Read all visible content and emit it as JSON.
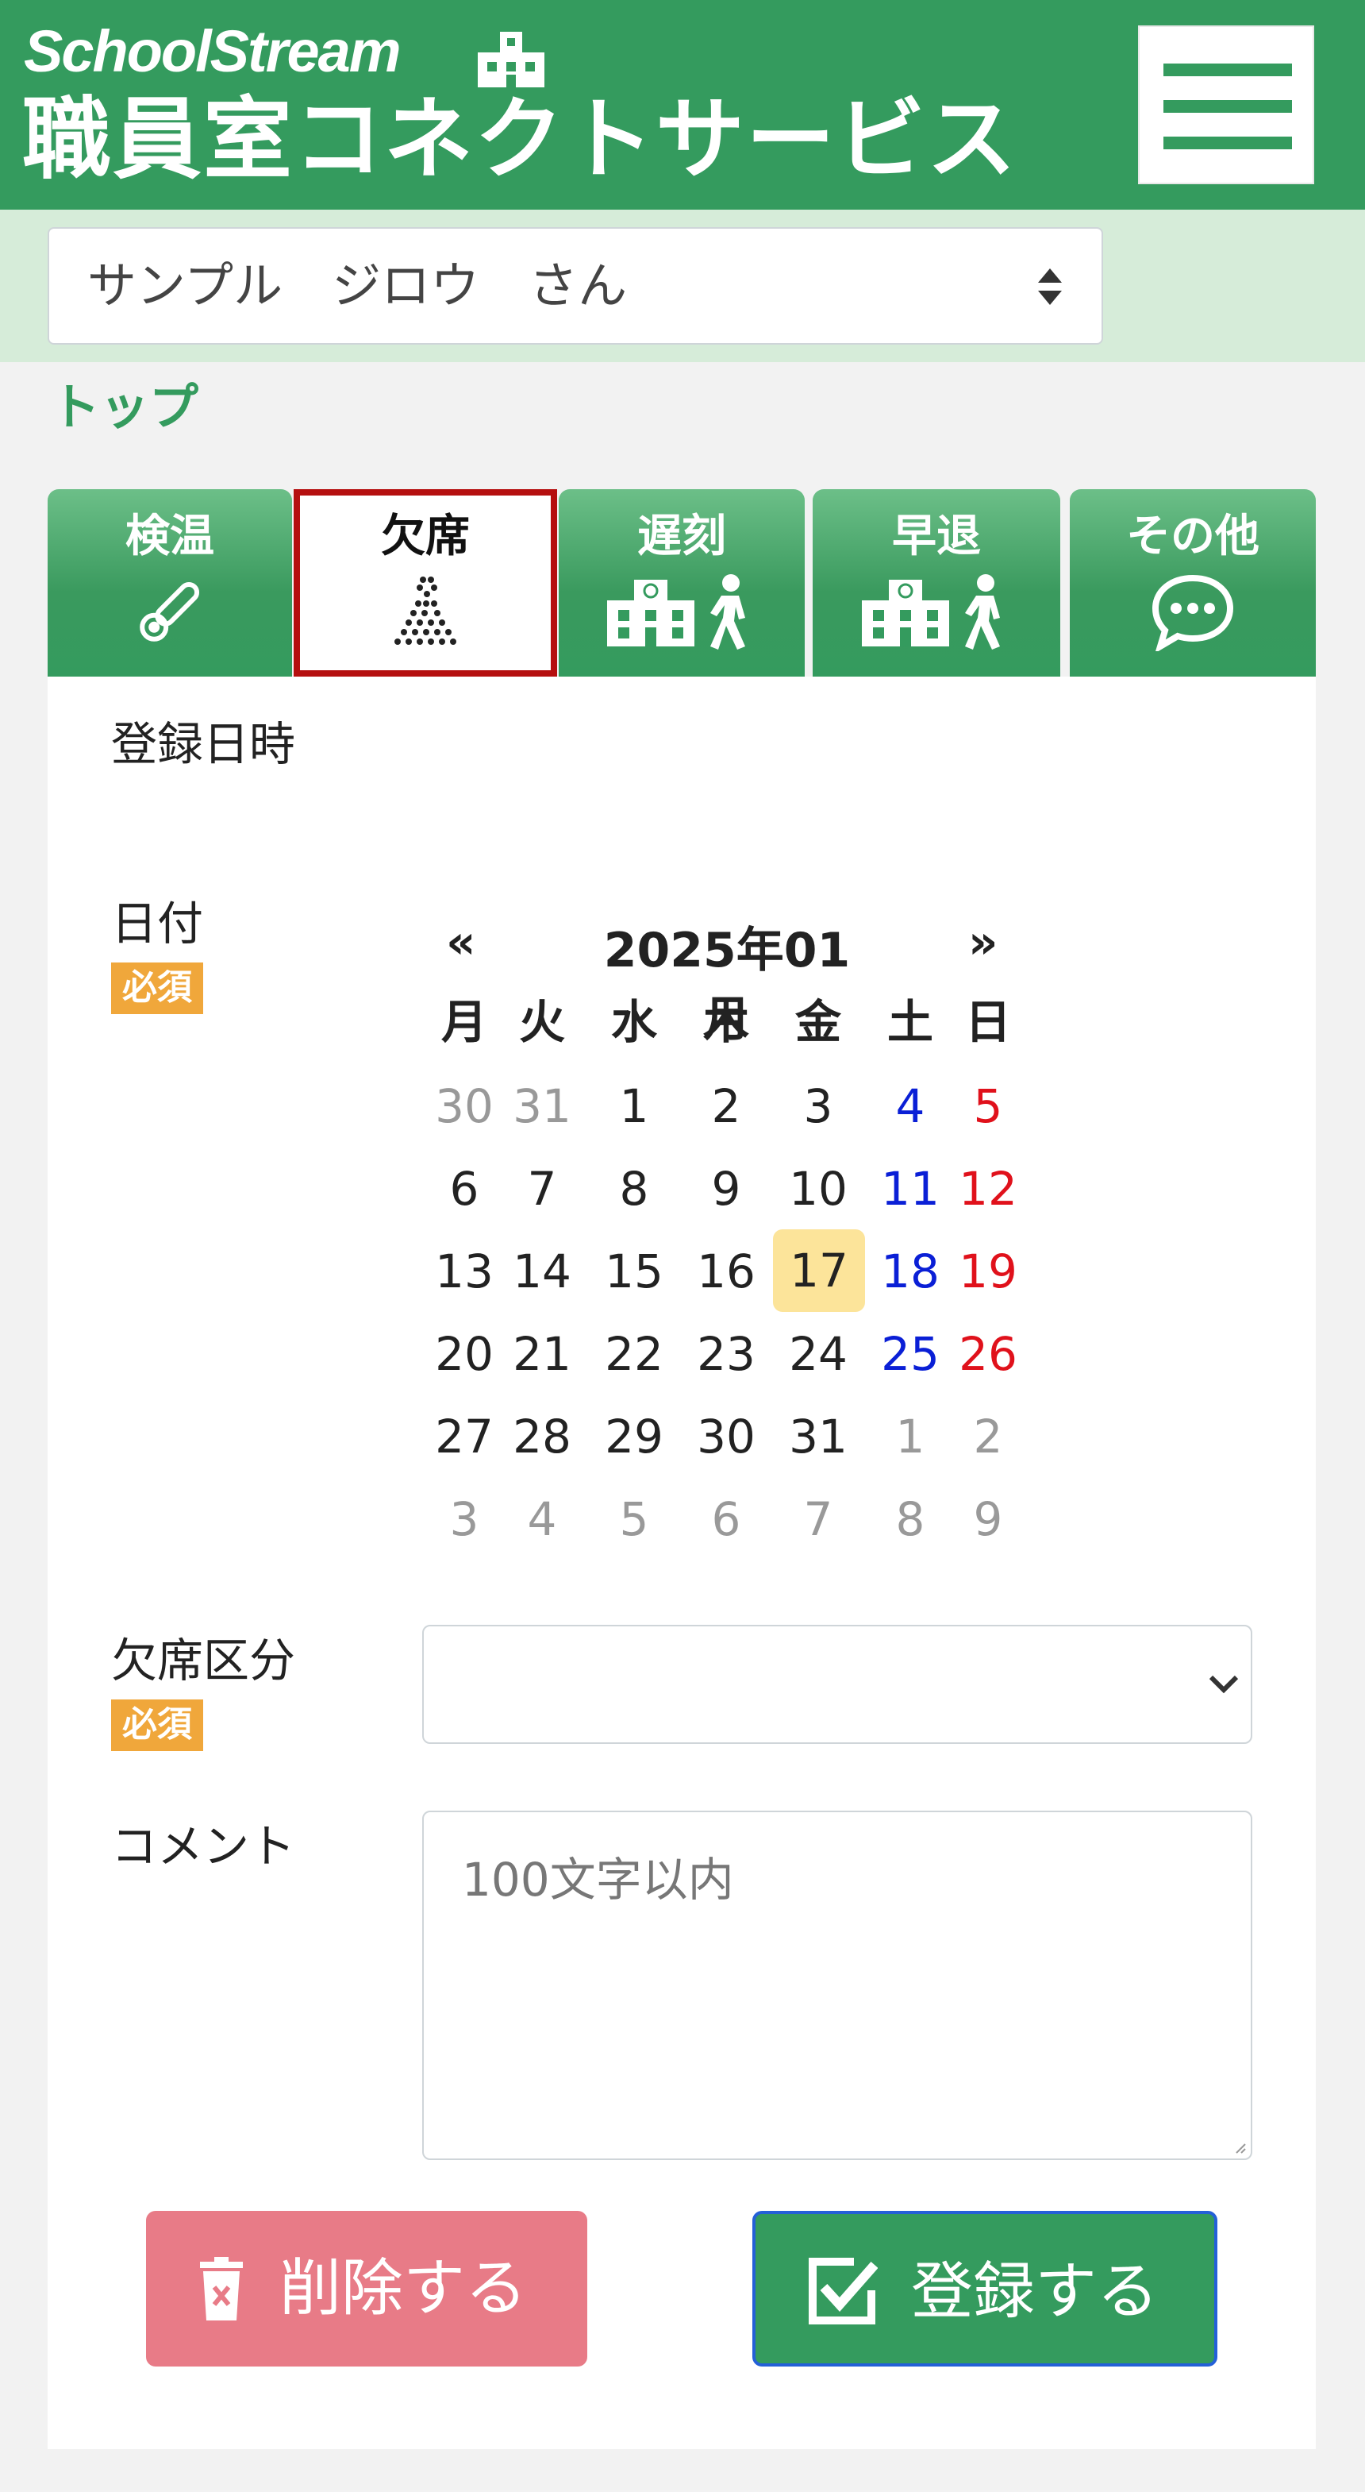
{
  "header": {
    "brand_top": "SchoolStream",
    "brand_main": "職員室コネクトサービス",
    "menu_icon": "hamburger-menu-icon",
    "brand_icon": "school-building-icon"
  },
  "user_select": {
    "value": "サンプル　ジロウ　さん"
  },
  "breadcrumb": {
    "label": "トップ"
  },
  "tabs": [
    {
      "label": "検温",
      "icon": "thermometer-icon",
      "active": false
    },
    {
      "label": "欠席",
      "icon": "dotted-person-icon",
      "active": true
    },
    {
      "label": "遅刻",
      "icon": "school-walking-icon",
      "active": false
    },
    {
      "label": "早退",
      "icon": "school-walking-icon",
      "active": false
    },
    {
      "label": "その他",
      "icon": "speech-bubble-icon",
      "active": false
    }
  ],
  "form": {
    "registered_label": "登録日時",
    "date_label": "日付",
    "required_badge": "必須",
    "absence_type_label": "欠席区分",
    "absence_type_value": "",
    "comment_label": "コメント",
    "comment_placeholder": "100文字以内"
  },
  "calendar": {
    "prev": "«",
    "next": "»",
    "title": "2025年01月",
    "weekdays": [
      "月",
      "火",
      "水",
      "木",
      "金",
      "土",
      "日"
    ],
    "selected_day": "17",
    "weeks": [
      [
        "30",
        "31",
        "1",
        "2",
        "3",
        "4",
        "5"
      ],
      [
        "6",
        "7",
        "8",
        "9",
        "10",
        "11",
        "12"
      ],
      [
        "13",
        "14",
        "15",
        "16",
        "17",
        "18",
        "19"
      ],
      [
        "20",
        "21",
        "22",
        "23",
        "24",
        "25",
        "26"
      ],
      [
        "27",
        "28",
        "29",
        "30",
        "31",
        "1",
        "2"
      ],
      [
        "3",
        "4",
        "5",
        "6",
        "7",
        "8",
        "9"
      ]
    ],
    "colors": {
      "other_month": "#999999",
      "weekday": "#222222",
      "saturday": "#0a1fd6",
      "sunday": "#e0111b",
      "today_bg": "#fce49a"
    }
  },
  "buttons": {
    "delete_label": "削除する",
    "delete_icon": "trash-icon",
    "submit_label": "登録する",
    "submit_icon": "checkbox-check-icon"
  },
  "colors": {
    "brand_green": "#349b5e",
    "light_green": "#d6ecd9",
    "active_tab_border": "#b50f0f",
    "required_orange": "#f0a73b",
    "delete_pink": "#e87b87"
  }
}
